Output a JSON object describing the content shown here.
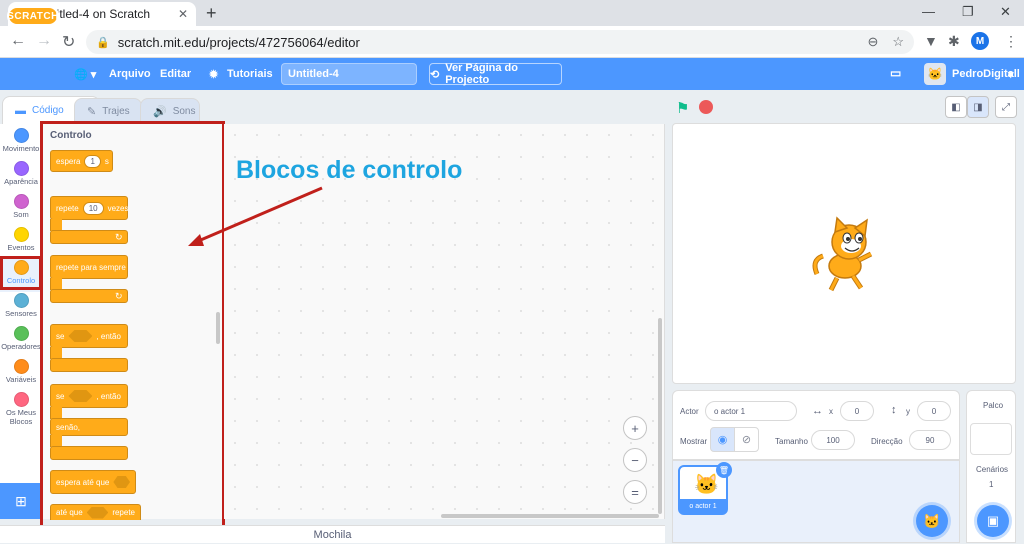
{
  "browser": {
    "tab_title": "Untitled-4 on Scratch",
    "favicon_letter": "S",
    "url": "scratch.mit.edu/projects/472756064/editor",
    "profile_initial": "M"
  },
  "menubar": {
    "logo": "SCRATCH",
    "file": "Arquivo",
    "edit": "Editar",
    "tutorials": "Tutoriais",
    "project_title": "Untitled-4",
    "share_button": "Ver Página do Projecto",
    "username": "PedroDigitall"
  },
  "editor_tabs": {
    "code": "Código",
    "costumes": "Trajes",
    "sounds": "Sons"
  },
  "categories": [
    {
      "label": "Movimento",
      "color": "#4c97ff"
    },
    {
      "label": "Aparência",
      "color": "#9966ff"
    },
    {
      "label": "Som",
      "color": "#cf63cf"
    },
    {
      "label": "Eventos",
      "color": "#ffd500"
    },
    {
      "label": "Controlo",
      "color": "#ffab19"
    },
    {
      "label": "Sensores",
      "color": "#5cb1d6"
    },
    {
      "label": "Operadores",
      "color": "#59c059"
    },
    {
      "label": "Variáveis",
      "color": "#ff8c1a"
    },
    {
      "label": "Os Meus Blocos",
      "color": "#ff6680"
    }
  ],
  "palette": {
    "header": "Controlo",
    "wait": {
      "label": "espera",
      "value": "1",
      "unit": "s"
    },
    "repeat": {
      "label": "repete",
      "value": "10",
      "suffix": "vezes"
    },
    "forever": {
      "label": "repete para sempre"
    },
    "if_then": {
      "if": "se",
      "then": ", então"
    },
    "if_else": {
      "if": "se",
      "then": ", então",
      "else": "senão,"
    },
    "wait_until": {
      "label": "espera até que"
    },
    "repeat_until": {
      "label": "até que",
      "suffix": "repete"
    }
  },
  "annotation": "Blocos de controlo",
  "zoom": {
    "in": "+",
    "out": "−",
    "reset": "="
  },
  "backpack": "Mochila",
  "sprite_info": {
    "sprite_label": "Actor",
    "sprite_name": "o actor 1",
    "x_label": "x",
    "x_value": "0",
    "y_label": "y",
    "y_value": "0",
    "show_label": "Mostrar",
    "size_label": "Tamanho",
    "size_value": "100",
    "direction_label": "Direcção",
    "direction_value": "90"
  },
  "sprite_list": {
    "thumb_name": "o actor 1"
  },
  "stage_panel": {
    "title": "Palco",
    "backdrops_label": "Cenários",
    "backdrops_count": "1"
  },
  "accent_color": "#4c97ff",
  "control_color": "#ffab19",
  "highlight_color": "#c0201b"
}
